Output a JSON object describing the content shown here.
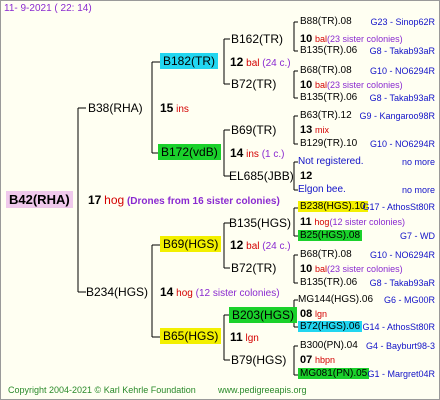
{
  "header": {
    "date": "11-  9-2021 ( 22: 14)"
  },
  "footer": {
    "copyright": "Copyright 2004-2021 © Karl Kehrle Foundation",
    "site": "www.pedigreeapis.org"
  },
  "root": {
    "name": "B42(RHA)",
    "num": "17",
    "breed": "hog",
    "note": "(Drones from 16 sister colonies)"
  },
  "gen1": [
    {
      "name": "B38(RHA)",
      "num": "15",
      "breed": "ins"
    },
    {
      "name": "B234(HGS)",
      "num": "14",
      "breed": "hog",
      "note": "(12 sister colonies)"
    }
  ],
  "gen2": [
    {
      "name": "B182(TR)",
      "num": "12",
      "breed": "bal",
      "note": "(24 c.)"
    },
    {
      "name": "B172(vdB)",
      "num": "14",
      "breed": "ins",
      "note": "(1 c.)"
    },
    {
      "name": "B69(HGS)",
      "num": "12",
      "breed": "bal",
      "note": "(24 c.)"
    },
    {
      "name": "B65(HGS)",
      "num": "11",
      "breed": "lgn"
    }
  ],
  "gen3": [
    {
      "name": "B162(TR)",
      "num": "10",
      "breed": "bal",
      "note": "(23 sister colonies)"
    },
    {
      "name": "B72(TR)",
      "num": "10",
      "breed": "bal",
      "note": "(23 sister colonies)"
    },
    {
      "name": "B69(TR)",
      "num": "13",
      "breed": "mix"
    },
    {
      "name": "EL685(JBB)",
      "num": "12"
    },
    {
      "name": "B135(HGS)",
      "num": "11",
      "breed": "hog",
      "note": "(12 sister colonies)"
    },
    {
      "name": "B72(TR)",
      "num": "10",
      "breed": "bal",
      "note": "(23 sister colonies)"
    },
    {
      "name": "B203(HGS)",
      "num": "08",
      "breed": "lgn"
    },
    {
      "name": "B79(HGS)",
      "num": "07",
      "breed": "hbpn"
    }
  ],
  "gen4": [
    {
      "name": "B88(TR).08",
      "info": "G23 - Sinop62R"
    },
    {
      "name": "B135(TR).06",
      "info": "G8 - Takab93aR"
    },
    {
      "name": "B68(TR).08",
      "info": "G10 - NO6294R"
    },
    {
      "name": "B135(TR).06",
      "info": "G8 - Takab93aR"
    },
    {
      "name": "B63(TR).12",
      "info": "G9 - Kangaroo98R"
    },
    {
      "name": "B129(TR).10",
      "info": "G10 - NO6294R"
    },
    {
      "name": "Not registered.",
      "info": "no more"
    },
    {
      "name": "Elgon bee.",
      "info": "no more"
    },
    {
      "name": "B238(HGS).10",
      "info": "G17 - AthosSt80R"
    },
    {
      "name": "B25(HGS).08",
      "info": "G7 - WD"
    },
    {
      "name": "B68(TR).08",
      "info": "G10 - NO6294R"
    },
    {
      "name": "B135(TR).06",
      "info": "G8 - Takab93aR"
    },
    {
      "name": "MG144(HGS).06",
      "info": "G6 - MG00R"
    },
    {
      "name": "B72(HGS).06",
      "info": "G14 - AthosSt80R"
    },
    {
      "name": "B300(PN).04",
      "info": "G4 - Bayburt98-3"
    },
    {
      "name": "MG081(PN).05",
      "info": "G1 - Margret04R"
    }
  ]
}
